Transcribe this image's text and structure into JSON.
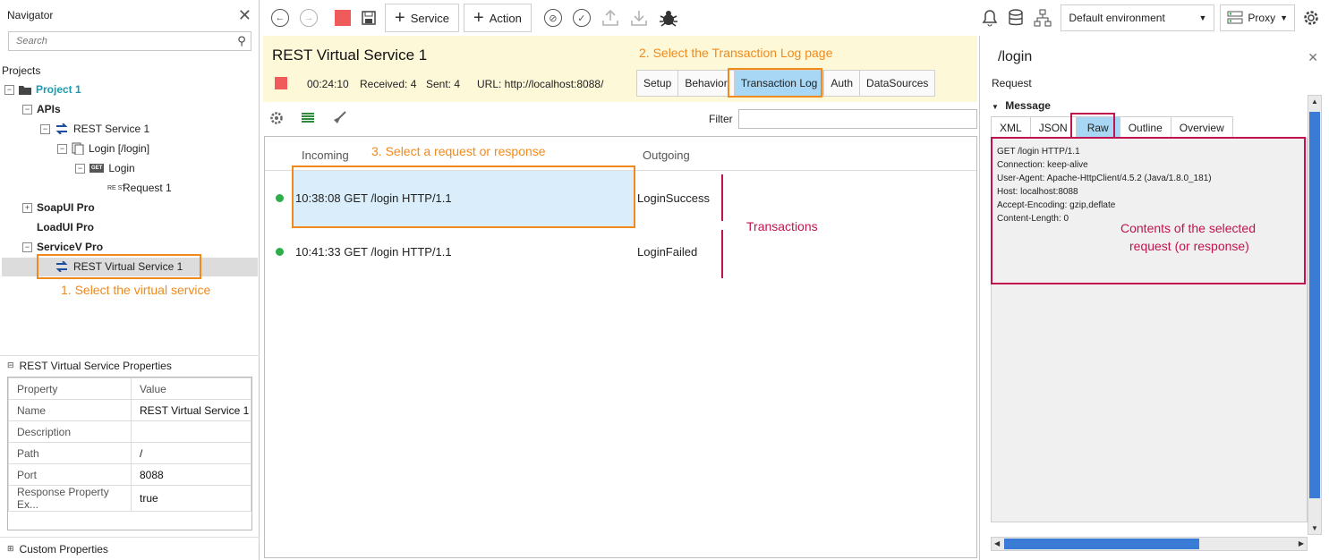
{
  "navigator": {
    "title": "Navigator",
    "search_placeholder": "Search",
    "projects_label": "Projects",
    "tree": {
      "project": "Project 1",
      "apis": "APIs",
      "rest_service": "REST Service 1",
      "login_resource": "Login [/login]",
      "login_method": "Login",
      "request": "Request 1",
      "soapui": "SoapUI Pro",
      "loadui": "LoadUI Pro",
      "servicev": "ServiceV Pro",
      "virtual_service": "REST Virtual Service 1",
      "get_badge": "GET",
      "rest_badge": "RE ST"
    },
    "properties_title": "REST Virtual Service Properties",
    "properties_header": {
      "property": "Property",
      "value": "Value"
    },
    "properties": [
      {
        "name": "Name",
        "value": "REST Virtual Service 1"
      },
      {
        "name": "Description",
        "value": ""
      },
      {
        "name": "Path",
        "value": "/"
      },
      {
        "name": "Port",
        "value": "8088"
      },
      {
        "name": "Response Property Ex...",
        "value": "true"
      }
    ],
    "custom_properties": "Custom Properties"
  },
  "toolbar": {
    "service_label": "Service",
    "action_label": "Action",
    "environment": "Default environment",
    "proxy_label": "Proxy"
  },
  "service": {
    "title": "REST Virtual Service 1",
    "time": "00:24:10",
    "received": "Received: 4",
    "sent": "Sent: 4",
    "url": "URL: http://localhost:8088/",
    "tabs": [
      "Setup",
      "Behavior",
      "Transaction Log",
      "Auth",
      "DataSources"
    ],
    "active_tab": "Transaction Log"
  },
  "log": {
    "filter_label": "Filter",
    "filter_value": "",
    "columns": {
      "incoming": "Incoming",
      "outgoing": "Outgoing"
    },
    "rows": [
      {
        "incoming": "10:38:08 GET /login HTTP/1.1",
        "outgoing": "LoginSuccess"
      },
      {
        "incoming": "10:41:33 GET /login HTTP/1.1",
        "outgoing": "LoginFailed"
      }
    ]
  },
  "annotations": {
    "step1": "1. Select the virtual service",
    "step2": "2. Select the Transaction Log page",
    "step3": "3. Select a request or response",
    "transactions": "Transactions",
    "contents_line1": "Contents of the selected",
    "contents_line2": "request (or response)"
  },
  "detail": {
    "title": "/login",
    "request_label": "Request",
    "message_label": "Message",
    "tabs": [
      "XML",
      "JSON",
      "Raw",
      "Outline",
      "Overview"
    ],
    "active_tab": "Raw",
    "raw_lines": [
      "GET /login HTTP/1.1",
      "Connection: keep-alive",
      "User-Agent: Apache-HttpClient/4.5.2 (Java/1.8.0_181)",
      "Host: localhost:8088",
      "Accept-Encoding: gzip,deflate",
      "Content-Length: 0"
    ]
  },
  "colors": {
    "accent_orange": "#f08a1c",
    "annotation_pink": "#c0134f",
    "active_tab": "#a7d7f5",
    "header_bg": "#fdf8d8",
    "status_green": "#2eae4a"
  }
}
